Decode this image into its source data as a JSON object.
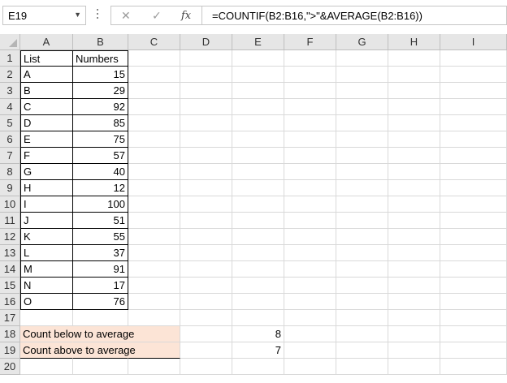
{
  "name_box": {
    "value": "E19",
    "dropdown_icon": "chevron-down-icon"
  },
  "formula_bar": {
    "cancel_icon": "✕",
    "enter_icon": "✓",
    "fx_label": "fx",
    "formula": "=COUNTIF(B2:B16,\">\"&AVERAGE(B2:B16))"
  },
  "columns": [
    "A",
    "B",
    "C",
    "D",
    "E",
    "F",
    "G",
    "H",
    "I"
  ],
  "rows": [
    "1",
    "2",
    "3",
    "4",
    "5",
    "6",
    "7",
    "8",
    "9",
    "10",
    "11",
    "12",
    "13",
    "14",
    "15",
    "16",
    "17",
    "18",
    "19",
    "20"
  ],
  "table": {
    "headers": [
      "List",
      "Numbers"
    ],
    "data": [
      [
        "A",
        "15"
      ],
      [
        "B",
        "29"
      ],
      [
        "C",
        "92"
      ],
      [
        "D",
        "85"
      ],
      [
        "E",
        "75"
      ],
      [
        "F",
        "57"
      ],
      [
        "G",
        "40"
      ],
      [
        "H",
        "12"
      ],
      [
        "I",
        "100"
      ],
      [
        "J",
        "51"
      ],
      [
        "K",
        "55"
      ],
      [
        "L",
        "37"
      ],
      [
        "M",
        "91"
      ],
      [
        "N",
        "17"
      ],
      [
        "O",
        "76"
      ]
    ]
  },
  "summary": [
    {
      "label": "Count below to average",
      "value": "8"
    },
    {
      "label": "Count above to average",
      "value": "7"
    }
  ],
  "colors": {
    "summary_fill": "#fce4d6",
    "header_fill": "#e6e6e6",
    "gridline": "#d9d9d9"
  }
}
